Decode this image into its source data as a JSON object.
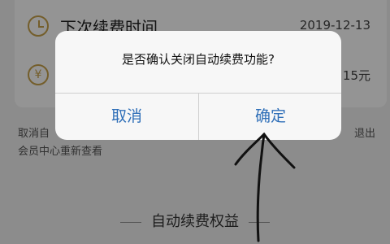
{
  "background_page": {
    "rows": [
      {
        "label": "下次续费时间",
        "value": "2019-12-13",
        "icon": "clock-icon"
      },
      {
        "label": "",
        "value": "15元",
        "icon": "yen-icon"
      }
    ],
    "note_line1_left": "取消自",
    "note_line1_right": "退出",
    "note_line2": "会员中心重新查看",
    "section_title": "自动续费权益"
  },
  "dialog": {
    "message": "是否确认关闭自动续费功能?",
    "cancel_label": "取消",
    "confirm_label": "确定",
    "button_color": "#2f6fb8"
  },
  "annotation": {
    "type": "hand-drawn-arrow",
    "target": "confirm-button"
  }
}
